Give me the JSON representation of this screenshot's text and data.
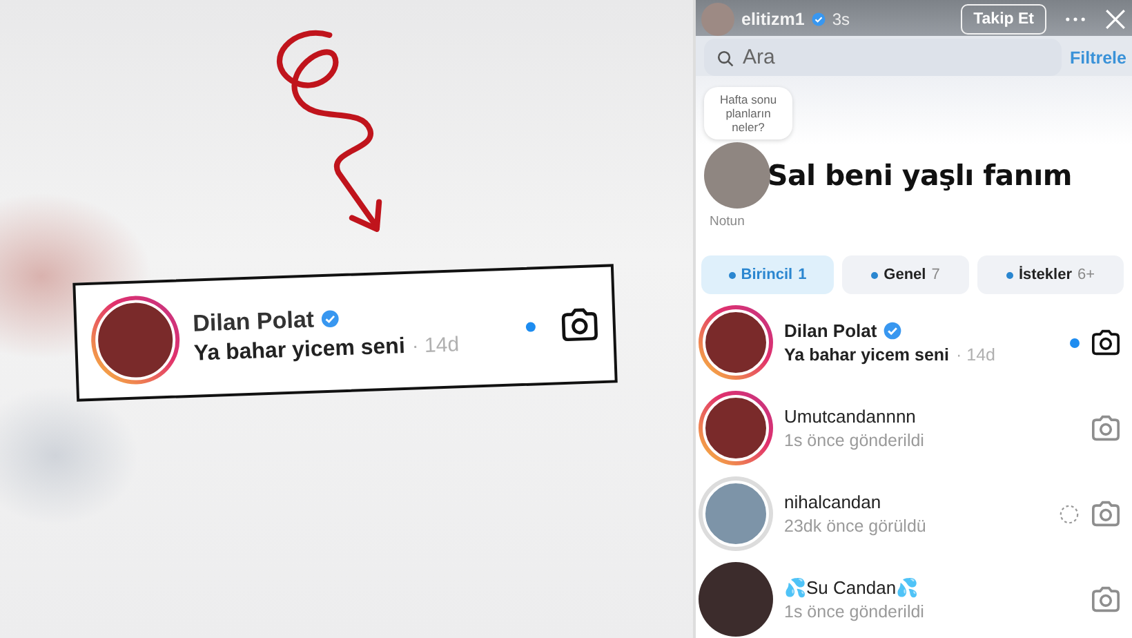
{
  "callout": {
    "name": "Dilan Polat",
    "verified": true,
    "message": "Ya bahar yicem seni",
    "time": "· 14d",
    "unread": true
  },
  "story_header": {
    "username": "elitizm1",
    "verified": true,
    "age": "3s",
    "follow_button": "Takip Et"
  },
  "search": {
    "placeholder": "Ara",
    "filter_link": "Filtrele"
  },
  "note": {
    "bubble": "Hafta sonu planların neler?",
    "label": "Notun"
  },
  "sticker": {
    "text": "Sal beni yaşlı fanım"
  },
  "tabs": [
    {
      "label": "Birincil",
      "count": "1",
      "selected": true
    },
    {
      "label": "Genel",
      "count": "7",
      "selected": false
    },
    {
      "label": "İstekler",
      "count": "6+",
      "selected": false
    }
  ],
  "conversations": [
    {
      "name": "Dilan Polat",
      "verified": true,
      "message": "Ya bahar yicem seni",
      "time": "· 14d",
      "unread": true,
      "has_story": true,
      "story_viewed": false,
      "sending": false
    },
    {
      "name": "Umutcandannnn",
      "verified": false,
      "message": "1s önce gönderildi",
      "unread": false,
      "has_story": true,
      "story_viewed": false,
      "sending": false
    },
    {
      "name": "nihalcandan",
      "verified": false,
      "message": "23dk önce görüldü",
      "unread": false,
      "has_story": true,
      "story_viewed": true,
      "sending": true
    },
    {
      "name": "💦Su Candan💦",
      "verified": false,
      "message": "1s önce gönderildi",
      "unread": false,
      "has_story": false,
      "sending": false
    }
  ]
}
